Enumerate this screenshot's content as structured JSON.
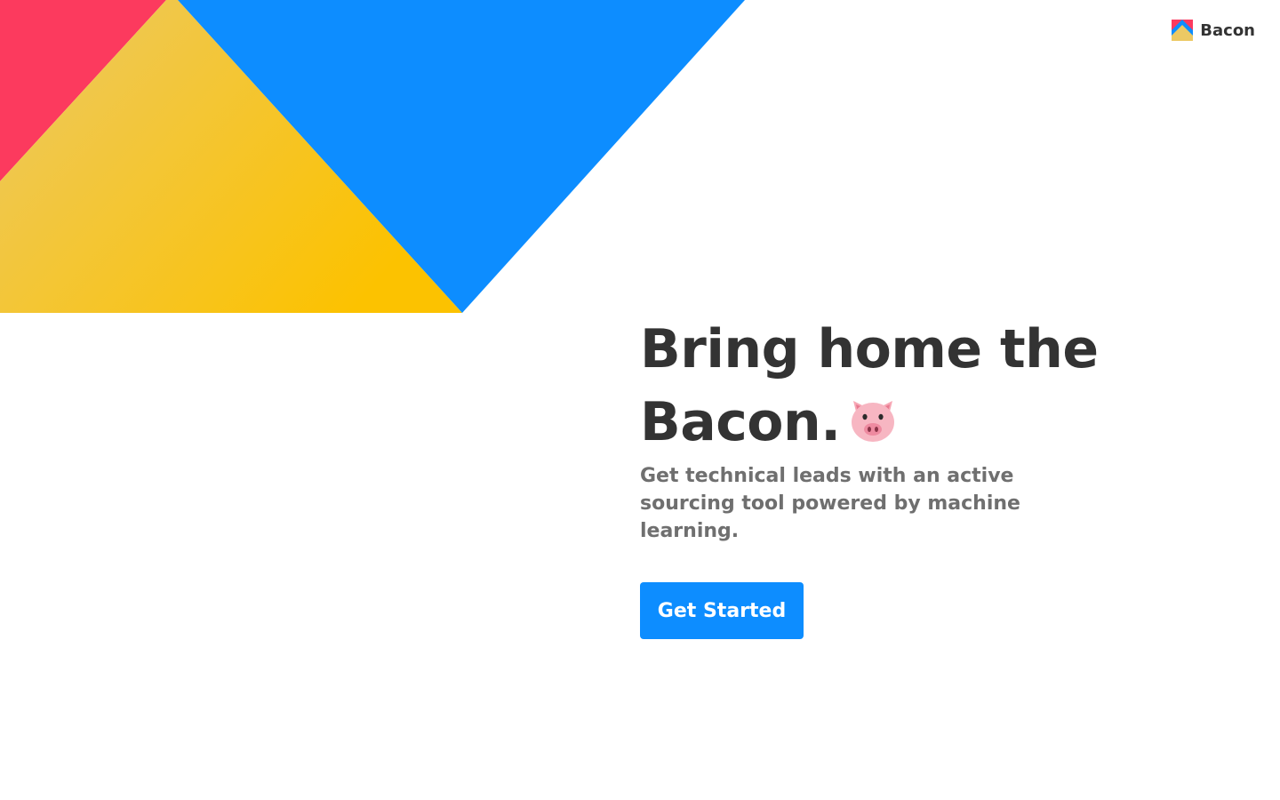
{
  "brand": {
    "name": "Bacon",
    "logo_icon": "bacon-logo-icon"
  },
  "hero": {
    "headline_line1": "Bring home the",
    "headline_line2": "Bacon.",
    "headline_icon": "pig-face-icon",
    "subtitle": "Get technical leads with an active sourcing tool powered by machine learning.",
    "cta_label": "Get Started"
  },
  "colors": {
    "red": "#fc3a5e",
    "yellow": "#fcc200",
    "yellow_light": "#ecc964",
    "blue": "#0d8dff",
    "heading_text": "#333333",
    "subtitle_text": "#6f6f6f",
    "background": "#ffffff"
  }
}
